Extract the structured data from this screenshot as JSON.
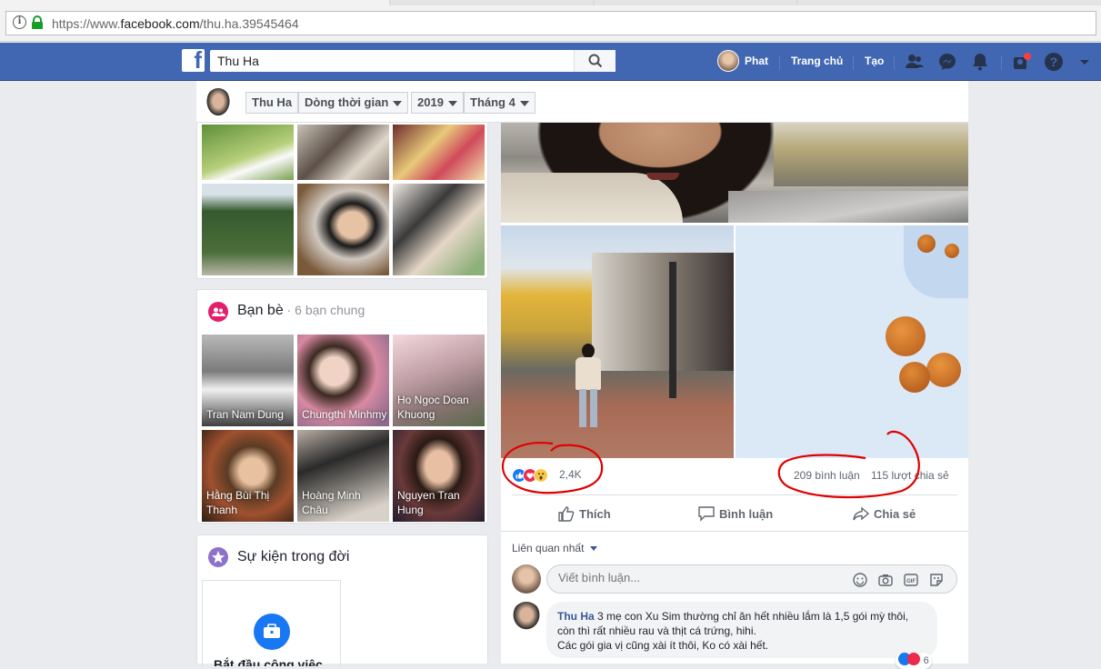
{
  "browser": {
    "url_prefix": "https://www.",
    "url_domain": "facebook.com",
    "url_path": "/thu.ha.39545464"
  },
  "topnav": {
    "search_value": "Thu Ha",
    "user_name": "Phat",
    "home_label": "Trang chủ",
    "create_label": "Tạo"
  },
  "timeline_bar": {
    "name": "Thu Ha",
    "section": "Dòng thời gian",
    "year": "2019",
    "month": "Tháng 4"
  },
  "friends": {
    "title": "Bạn bè",
    "mutual": " · 6 bạn chung",
    "items": [
      {
        "name": "Tran Nam Dung"
      },
      {
        "name": "Chungthi Minhmy"
      },
      {
        "name": "Ho Ngoc Doan Khuong"
      },
      {
        "name": "Hằng Bùi Thị Thanh"
      },
      {
        "name": "Hoàng Minh Châu"
      },
      {
        "name": "Nguyen Tran Hung"
      }
    ]
  },
  "life_events": {
    "title": "Sự kiện trong đời",
    "start_label": "Bắt đầu công việc"
  },
  "post": {
    "reaction_count": "2,4K",
    "comments": "209 bình luận",
    "shares": "115 lượt chia sẻ",
    "like_label": "Thích",
    "comment_label": "Bình luận",
    "share_label": "Chia sẻ",
    "sort_label": "Liên quan nhất",
    "comment_placeholder": "Viết bình luận...",
    "first_comment": {
      "author": "Thu Ha",
      "text1": " 3 mẹ con Xu Sim thường chỉ ăn hết nhiều lắm là 1,5 gói mỳ thôi, còn thì rất nhiều rau và thịt cá trứng, hihi.",
      "text2": "Các gói gia vị cũng xài ít thôi, Ko có xài hết.",
      "reactions": "6"
    }
  },
  "colors": {
    "fb_blue": "#4267b2",
    "like_blue": "#1877f2",
    "love_red": "#f0284a",
    "annotation_red": "#e00000"
  }
}
